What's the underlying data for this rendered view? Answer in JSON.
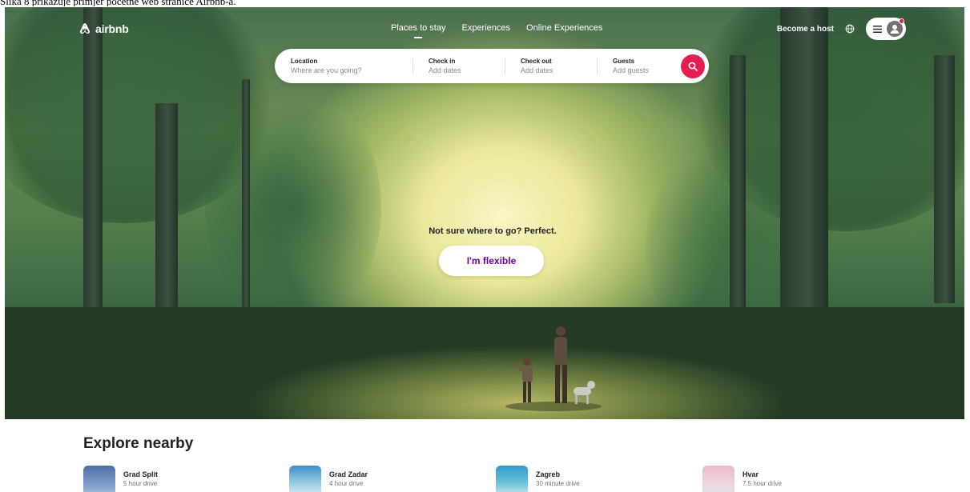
{
  "caption": "Slika 8 prikazuje primjer početne web stranice Airbnb-a.",
  "brand": {
    "name": "airbnb",
    "color": "#ff385c",
    "icon": "airbnb-logo-icon"
  },
  "nav": {
    "tabs": [
      {
        "label": "Places to stay",
        "active": true
      },
      {
        "label": "Experiences",
        "active": false
      },
      {
        "label": "Online Experiences",
        "active": false
      }
    ],
    "become_host": "Become a host",
    "globe_icon": "globe-icon",
    "menu_icon": "hamburger-menu-icon",
    "avatar_icon": "user-avatar-icon"
  },
  "search": {
    "location": {
      "label": "Location",
      "placeholder": "Where are you going?"
    },
    "check_in": {
      "label": "Check in",
      "placeholder": "Add dates"
    },
    "check_out": {
      "label": "Check out",
      "placeholder": "Add dates"
    },
    "guests": {
      "label": "Guests",
      "placeholder": "Add guests"
    },
    "button_icon": "search-icon",
    "button_color": "#e51d53"
  },
  "hero": {
    "tagline": "Not sure where to go? Perfect.",
    "cta": "I'm flexible",
    "cta_color": "#6f019c"
  },
  "explore": {
    "title": "Explore nearby",
    "items": [
      {
        "name": "Grad Split",
        "distance": "5 hour drive"
      },
      {
        "name": "Grad Zadar",
        "distance": "4 hour drive"
      },
      {
        "name": "Zagreb",
        "distance": "30 minute drive"
      },
      {
        "name": "Hvar",
        "distance": "7.5 hour drive"
      }
    ]
  }
}
